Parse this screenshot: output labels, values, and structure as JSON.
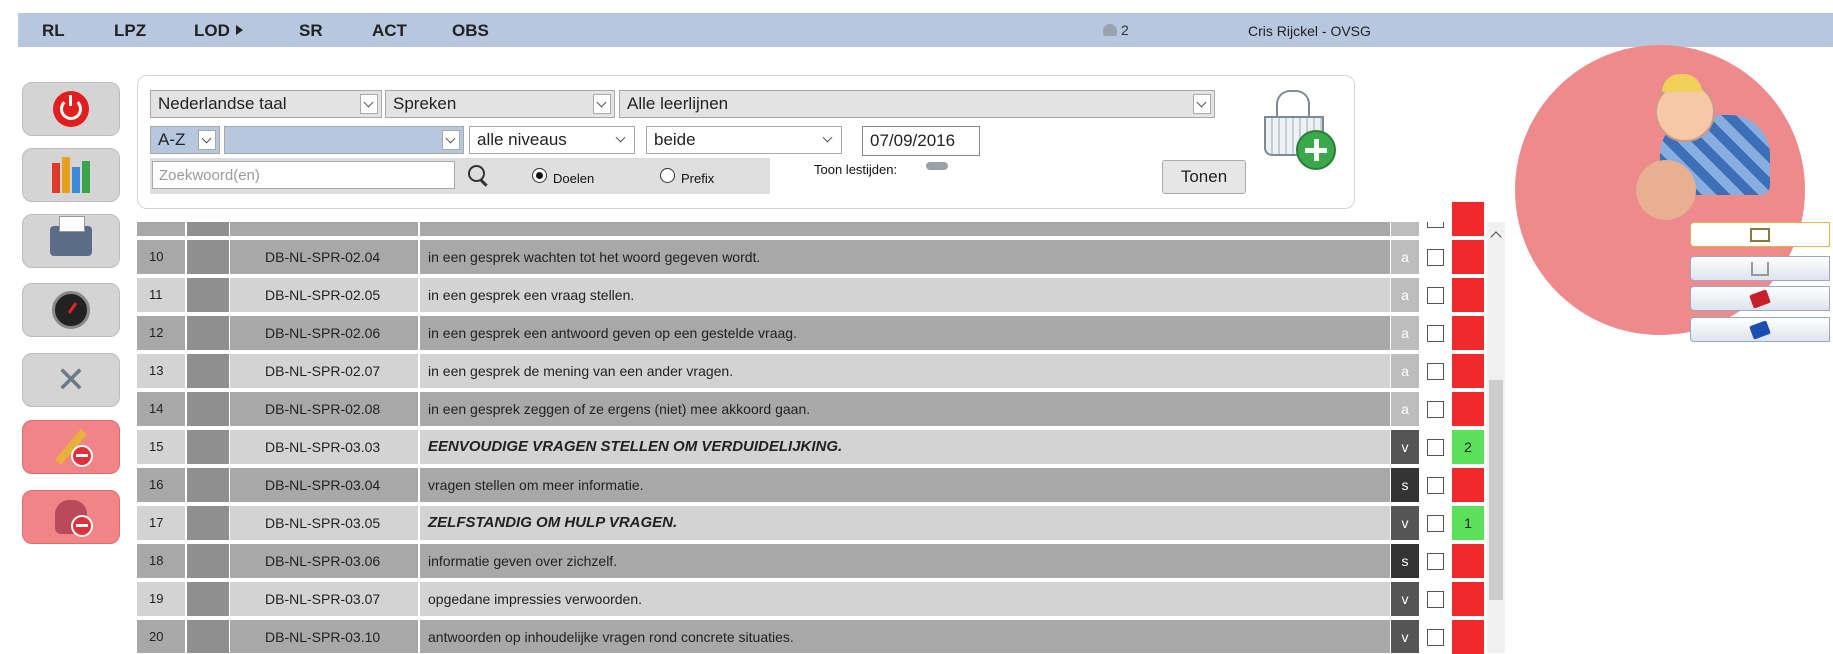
{
  "nav": {
    "items": [
      {
        "label": "RL"
      },
      {
        "label": "LPZ"
      },
      {
        "label": "LOD"
      },
      {
        "label": "SR"
      },
      {
        "label": "ACT"
      },
      {
        "label": "OBS"
      }
    ],
    "online_users": "2",
    "user_name": "Cris Rijckel - OVSG"
  },
  "sidebar": {
    "icons": [
      "power-icon",
      "books-icon",
      "printer-icon",
      "gauge-icon",
      "tools-icon",
      "pencil-remove-icon",
      "flask-remove-icon"
    ]
  },
  "filters": {
    "subject": "Nederlandse taal",
    "domain": "Spreken",
    "learning_line": "Alle leerlijnen",
    "sort": "A-Z",
    "category": "",
    "level": "alle niveaus",
    "scope": "beide",
    "date": "07/09/2016",
    "search_placeholder": "Zoekwoord(en)",
    "radio_goals": "Doelen",
    "radio_prefix": "Prefix",
    "show_lessons_label": "Toon lestijden:",
    "show_button": "Tonen"
  },
  "rows": [
    {
      "num": "10",
      "code": "DB-NL-SPR-02.04",
      "desc": "in een gesprek wachten tot het woord gegeven wordt.",
      "type": "a",
      "bold": false,
      "status_color": "#f02a2a",
      "status_text": ""
    },
    {
      "num": "11",
      "code": "DB-NL-SPR-02.05",
      "desc": "in een gesprek een vraag stellen.",
      "type": "a",
      "bold": false,
      "status_color": "#f02a2a",
      "status_text": ""
    },
    {
      "num": "12",
      "code": "DB-NL-SPR-02.06",
      "desc": "in een gesprek een antwoord geven op een gestelde vraag.",
      "type": "a",
      "bold": false,
      "status_color": "#f02a2a",
      "status_text": ""
    },
    {
      "num": "13",
      "code": "DB-NL-SPR-02.07",
      "desc": "in een gesprek de mening van een ander vragen.",
      "type": "a",
      "bold": false,
      "status_color": "#f02a2a",
      "status_text": ""
    },
    {
      "num": "14",
      "code": "DB-NL-SPR-02.08",
      "desc": "in een gesprek zeggen of ze ergens (niet) mee akkoord gaan.",
      "type": "a",
      "bold": false,
      "status_color": "#f02a2a",
      "status_text": ""
    },
    {
      "num": "15",
      "code": "DB-NL-SPR-03.03",
      "desc": "EENVOUDIGE VRAGEN STELLEN OM VERDUIDELIJKING.",
      "type": "v",
      "bold": true,
      "status_color": "#5ae05a",
      "status_text": "2"
    },
    {
      "num": "16",
      "code": "DB-NL-SPR-03.04",
      "desc": "vragen stellen om meer informatie.",
      "type": "s",
      "bold": false,
      "status_color": "#f02a2a",
      "status_text": ""
    },
    {
      "num": "17",
      "code": "DB-NL-SPR-03.05",
      "desc": "ZELFSTANDIG OM HULP VRAGEN.",
      "type": "v",
      "bold": true,
      "status_color": "#5ae05a",
      "status_text": "1"
    },
    {
      "num": "18",
      "code": "DB-NL-SPR-03.06",
      "desc": "informatie geven over zichzelf.",
      "type": "s",
      "bold": false,
      "status_color": "#f02a2a",
      "status_text": ""
    },
    {
      "num": "19",
      "code": "DB-NL-SPR-03.07",
      "desc": "opgedane impressies verwoorden.",
      "type": "v",
      "bold": false,
      "status_color": "#f02a2a",
      "status_text": ""
    },
    {
      "num": "20",
      "code": "DB-NL-SPR-03.10",
      "desc": "antwoorden op inhoudelijke vragen rond concrete situaties.",
      "type": "v",
      "bold": false,
      "status_color": "#f02a2a",
      "status_text": ""
    }
  ],
  "right_tabs": [
    "book-icon",
    "cart-icon",
    "red-book-icon",
    "blue-book-icon"
  ]
}
